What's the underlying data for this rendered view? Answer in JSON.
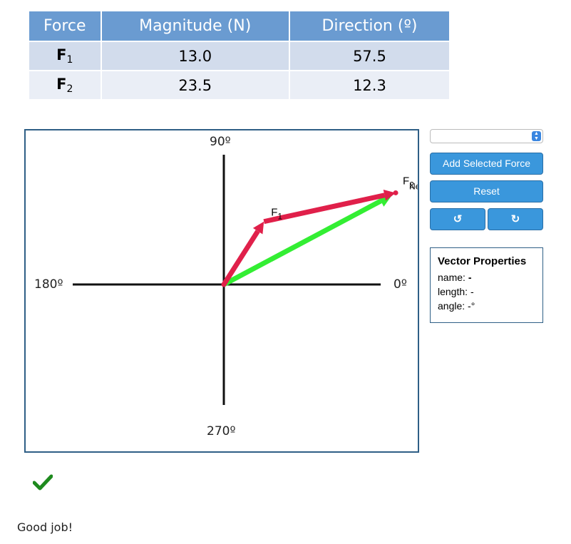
{
  "table": {
    "headers": [
      "Force",
      "Magnitude (N)",
      "Direction (º)"
    ],
    "rows": [
      {
        "force": "F",
        "sub": "1",
        "magnitude": "13.0",
        "direction": "57.5"
      },
      {
        "force": "F",
        "sub": "2",
        "magnitude": "23.5",
        "direction": "12.3"
      }
    ]
  },
  "plot": {
    "axis_labels": {
      "top": "90º",
      "left": "180º",
      "right": "0º",
      "bottom": "270º"
    },
    "vectors": [
      {
        "label": "F",
        "sub": "1",
        "magnitude": 13.0,
        "direction": 57.5,
        "color": "#e0204a"
      },
      {
        "label": "F",
        "sub": "2",
        "magnitude": 23.5,
        "direction": 12.3,
        "color": "#e0204a"
      },
      {
        "label": "F",
        "sub": "Net",
        "color": "#33ee33"
      }
    ]
  },
  "controls": {
    "select_value": "",
    "add_label": "Add Selected Force",
    "reset_label": "Reset",
    "undo_glyph": "↺",
    "redo_glyph": "↻"
  },
  "properties": {
    "title": "Vector Properties",
    "name_label": "name:",
    "name_value": "-",
    "length_label": "length:",
    "length_value": "-",
    "angle_label": "angle:",
    "angle_value": "-°"
  },
  "feedback": {
    "icon": "checkmark-icon",
    "text": "Good job!",
    "color": "#1e8a1e"
  }
}
